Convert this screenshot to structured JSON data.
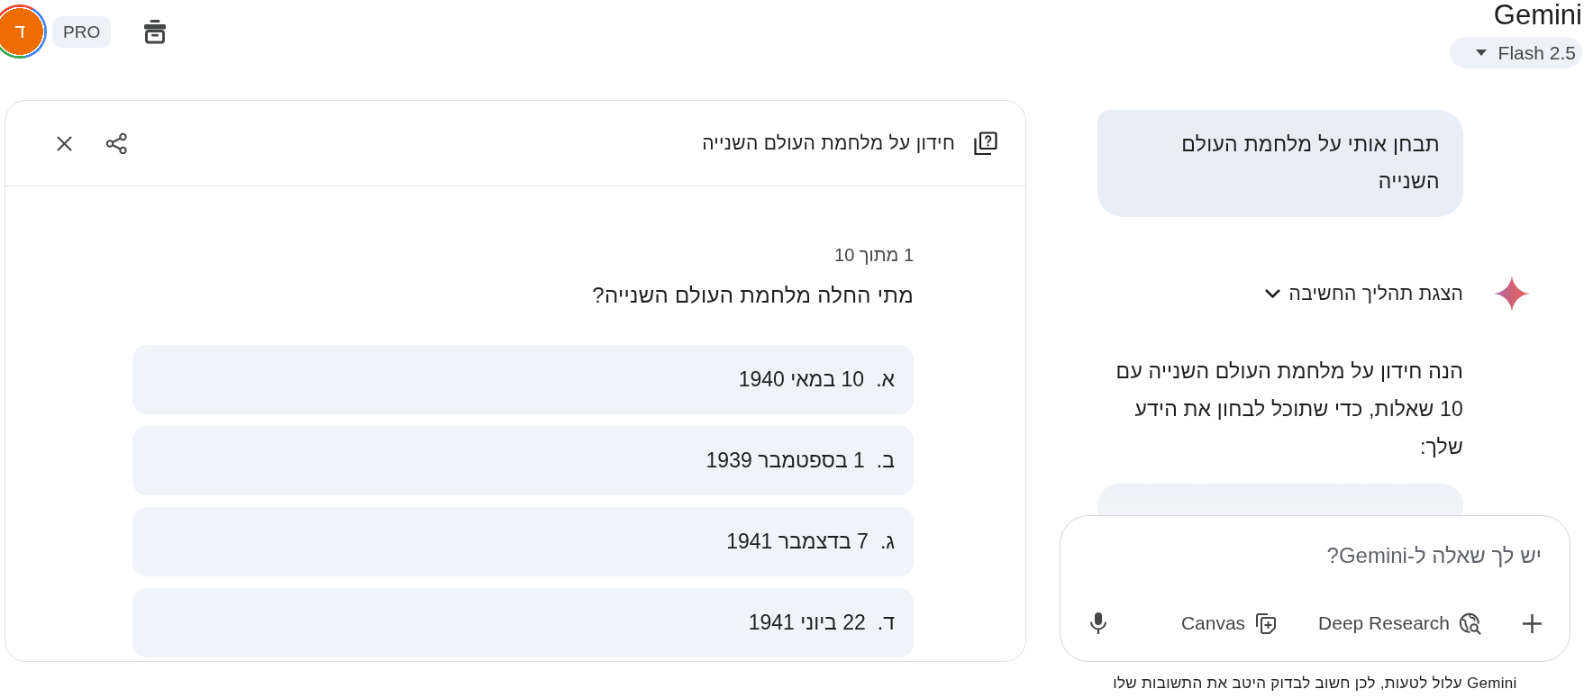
{
  "topbar": {
    "avatar": {
      "initial": "ד"
    },
    "plan_badge": "PRO",
    "app_title": "Gemini",
    "model_selector": {
      "label": "Flash 2.5"
    }
  },
  "quiz": {
    "title": "חידון על מלחמת העולם השנייה",
    "progress": "1 מתוך 10",
    "question": "מתי החלה מלחמת העולם השנייה?",
    "options": [
      {
        "letter": "א.",
        "text": "10 במאי 1940",
        "selected": false
      },
      {
        "letter": "ב.",
        "text": "1 בספטמבר 1939",
        "selected": false
      },
      {
        "letter": "ג.",
        "text": "7 בדצמבר 1941",
        "selected": false
      },
      {
        "letter": "ד.",
        "text": "22 ביוני 1941",
        "selected": false
      }
    ]
  },
  "chat": {
    "messages": [
      {
        "kind": "user",
        "text": "תבחן אותי על מלחמת העולם השנייה"
      },
      {
        "kind": "model",
        "thinking": {
          "label": "הצגת תהליך החשיבה",
          "expanded": false
        },
        "text": "הנה חידון על מלחמת העולם השנייה עם 10 שאלות, כדי שתוכל לבחון את הידע שלך:",
        "attachment": {
          "kind": "quiz_card"
        }
      }
    ],
    "input": {
      "placeholder": "יש לך שאלה ל-Gemini?"
    },
    "tools": [
      {
        "kind": "deep_research",
        "label": "Deep Research"
      },
      {
        "kind": "canvas",
        "label": "Canvas"
      }
    ],
    "disclaimer": "Gemini עלול לטעות, לכן חשוב לבדוק היטב את התשובות שלו"
  }
}
